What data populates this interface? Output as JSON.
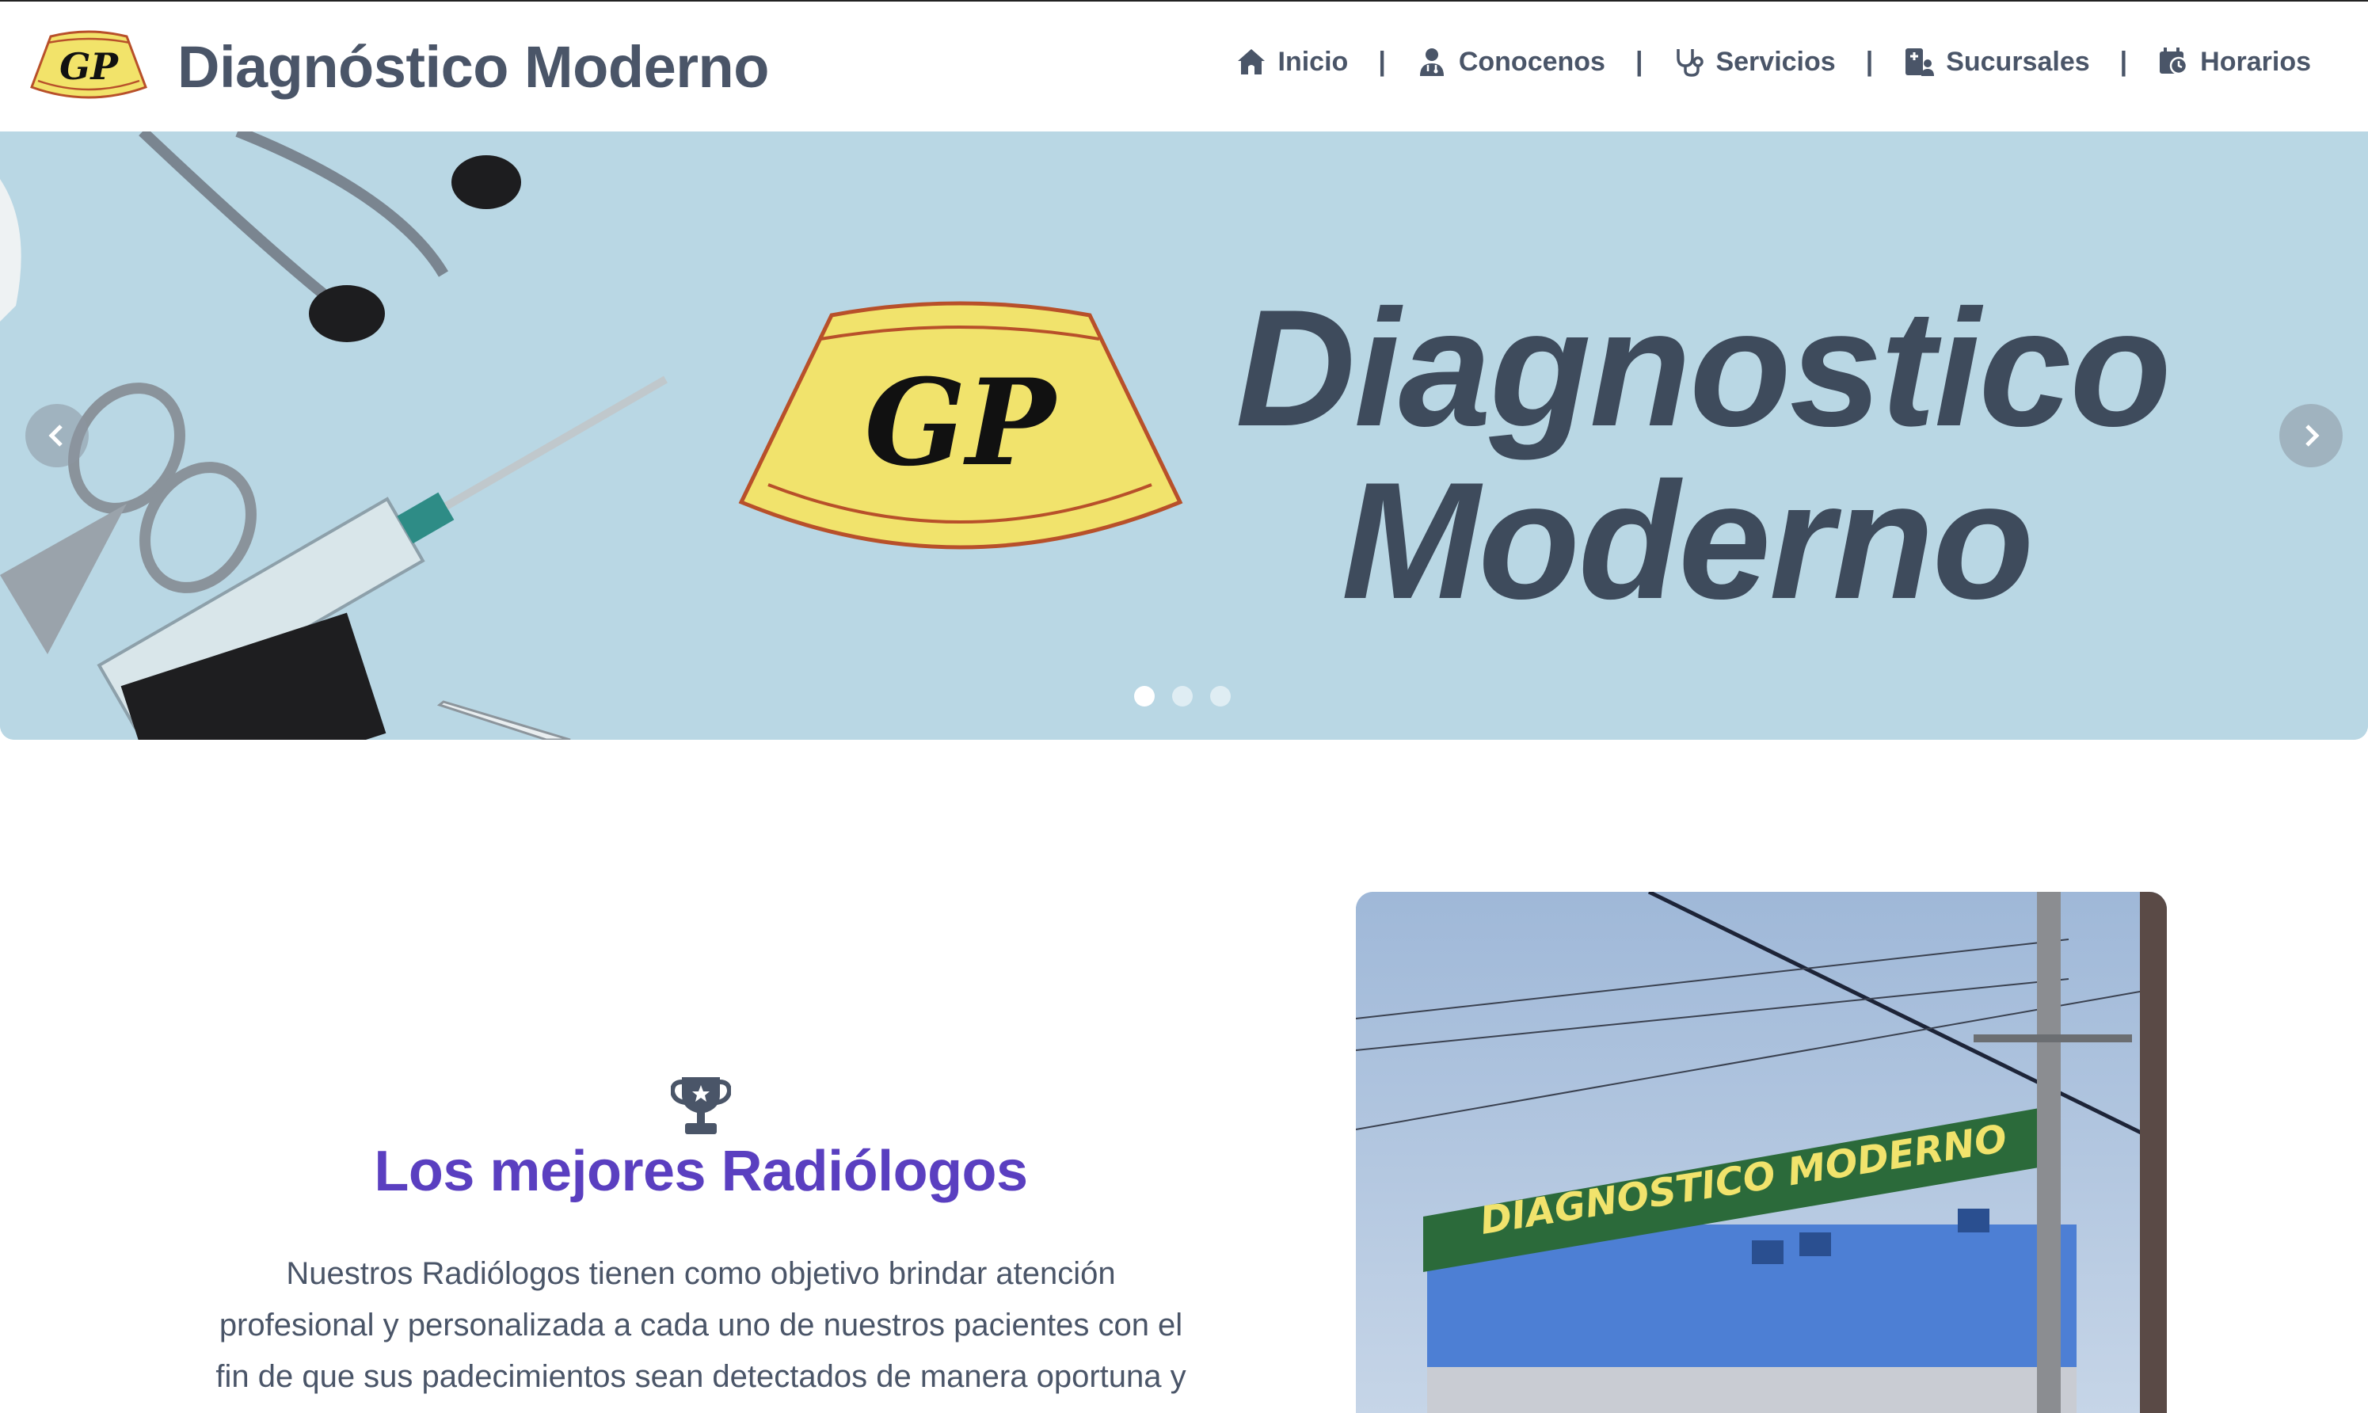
{
  "header": {
    "brand_name": "Diagnóstico Moderno",
    "logo_text": "GP",
    "nav": [
      {
        "label": "Inicio",
        "icon": "home-icon"
      },
      {
        "label": "Conocenos",
        "icon": "user-doctor-icon"
      },
      {
        "label": "Servicios",
        "icon": "stethoscope-icon"
      },
      {
        "label": "Sucursales",
        "icon": "hospital-user-icon"
      },
      {
        "label": "Horarios",
        "icon": "calendar-clock-icon"
      }
    ],
    "separator": "|"
  },
  "carousel": {
    "slide_logo_text": "GP",
    "title_line1": "Diagnostico",
    "title_line2": "Moderno",
    "prev_icon": "chevron-left-icon",
    "next_icon": "chevron-right-icon",
    "slide_count": 3,
    "active_slide": 1
  },
  "about": {
    "icon": "trophy-icon",
    "title": "Los mejores Radiólogos",
    "text": "Nuestros Radiólogos tienen como objetivo brindar atención profesional y personalizada a cada uno de nuestros pacientes con el fin de que sus padecimientos sean detectados de manera oportuna y",
    "photo_sign_text": "DIAGNOSTICO MODERNO"
  },
  "colors": {
    "brand_text": "#4a5568",
    "accent_purple": "#5a3fc0",
    "logo_yellow": "#f2e36a",
    "logo_border": "#b8502a",
    "carousel_bg": "#b9d7e4"
  }
}
